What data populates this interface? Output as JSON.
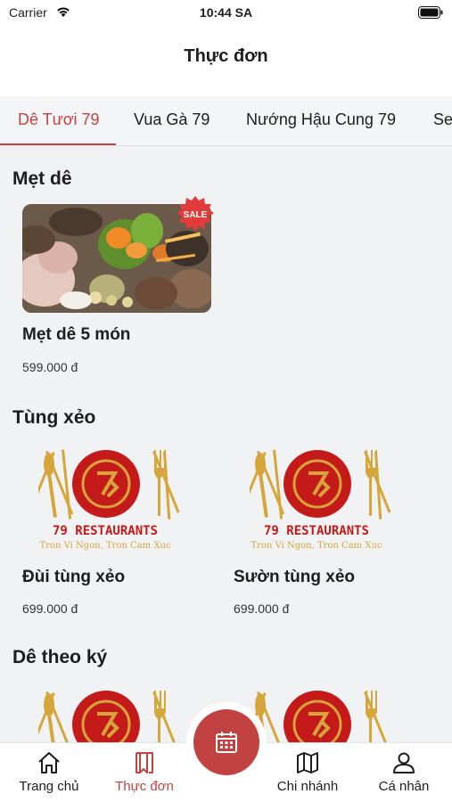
{
  "status_bar": {
    "carrier": "Carrier",
    "time": "10:44 SA"
  },
  "nav": {
    "title": "Thực đơn"
  },
  "tabs": [
    {
      "label": "Dê Tươi 79",
      "active": true
    },
    {
      "label": "Vua Gà 79",
      "active": false
    },
    {
      "label": "Nướng Hậu Cung 79",
      "active": false
    },
    {
      "label": "Se",
      "active": false
    }
  ],
  "sections": [
    {
      "title": "Mẹt dê",
      "items": [
        {
          "name": "Mẹt dê 5 món",
          "price": "599.000 đ",
          "image": "food-photo",
          "badge": "SALE"
        }
      ]
    },
    {
      "title": "Tùng xẻo",
      "items": [
        {
          "name": "Đùi tùng xẻo",
          "price": "699.000 đ",
          "image": "restaurant-logo"
        },
        {
          "name": "Sườn tùng xẻo",
          "price": "699.000 đ",
          "image": "restaurant-logo"
        }
      ]
    },
    {
      "title": "Dê theo ký",
      "items": [
        {
          "image": "restaurant-logo"
        },
        {
          "image": "restaurant-logo"
        }
      ]
    }
  ],
  "logo": {
    "brand": "79 RESTAURANTS",
    "tagline": "Tron Vi Ngon, Tron Cam Xuc"
  },
  "tab_bar": [
    {
      "label": "Trang chủ",
      "icon": "home-icon",
      "active": false
    },
    {
      "label": "Thực đơn",
      "icon": "book-icon",
      "active": true
    },
    {
      "label": "Chi nhánh",
      "icon": "map-icon",
      "active": false
    },
    {
      "label": "Cá nhân",
      "icon": "person-icon",
      "active": false
    }
  ],
  "fab": {
    "icon": "calendar-icon"
  },
  "colors": {
    "accent": "#c24242",
    "logo_red": "#c41a1a",
    "logo_gold": "#d6a63a"
  }
}
